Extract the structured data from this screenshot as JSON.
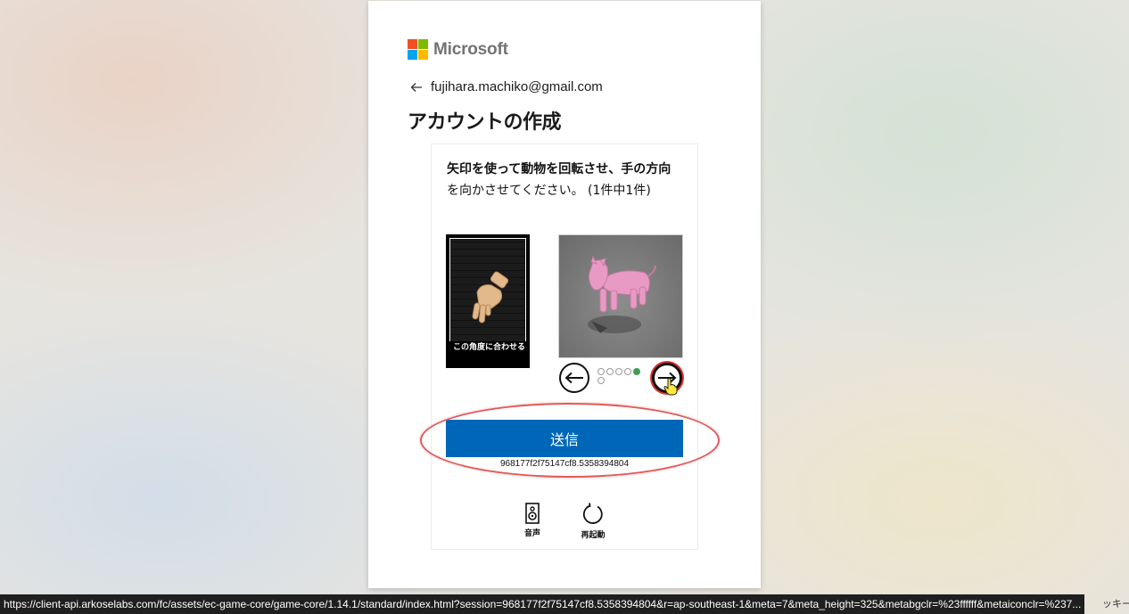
{
  "brand": {
    "name": "Microsoft",
    "colors": [
      "#f25022",
      "#7fba00",
      "#00a4ef",
      "#ffb900"
    ]
  },
  "identity": {
    "email": "fujihara.machiko@gmail.com",
    "back_icon": "arrow-left-icon"
  },
  "page_title": "アカウントの作成",
  "challenge": {
    "instruction_bold_1": "矢印を使って動物を回転させ、手の方向",
    "instruction_rest": "を向かさせてください。",
    "progress_text": "(1件中1件)",
    "hand_caption": "この角度に合わせる",
    "dots_total": 6,
    "dots_active_index": 4,
    "prev_icon": "arrow-left-icon",
    "next_icon": "arrow-right-icon",
    "submit_label": "送信",
    "session_id": "968177f2f75147cf8.5358394804",
    "audio_label": "音声",
    "restart_label": "再起動"
  },
  "status_bar": {
    "url": "https://client-api.arkoselabs.com/fc/assets/ec-game-core/game-core/1.14.1/standard/index.html?session=968177f2f75147cf8.5358394804&r=ap-southeast-1&meta=7&meta_height=325&metabgclr=%23ffffff&metaiconclr=%237...",
    "tail": "ッキー"
  },
  "colors": {
    "accent": "#0067b8",
    "highlight": "#e05a5a",
    "active_dot": "#3f9e52"
  }
}
